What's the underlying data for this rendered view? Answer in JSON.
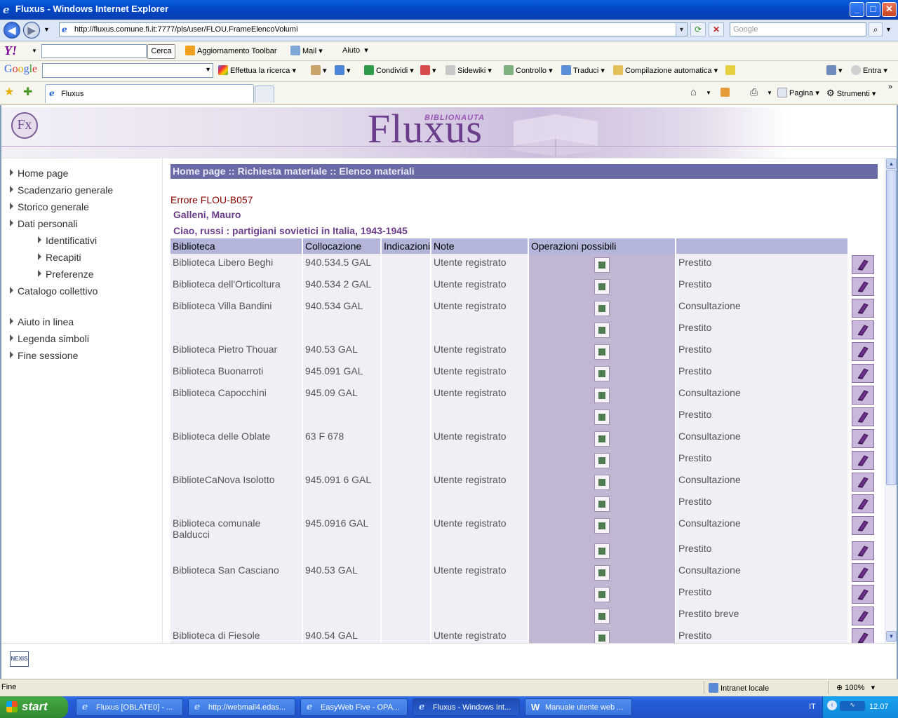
{
  "window": {
    "title": "Fluxus - Windows Internet Explorer",
    "min": "_",
    "max": "□",
    "close": "✕"
  },
  "address": {
    "url": "http://fluxus.comune.fi.it:7777/pls/user/FLOU.FrameElencoVolumi",
    "search_placeholder": "Google"
  },
  "yahoo_toolbar": {
    "logo": "Y!",
    "search_button": "Cerca",
    "update": "Aggiornamento Toolbar",
    "mail": "Mail",
    "help": "Aiuto"
  },
  "google_toolbar": {
    "logo": "Google",
    "search": "Effettua la ricerca",
    "share": "Condividi",
    "sidewiki": "Sidewiki",
    "check": "Controllo",
    "translate": "Traduci",
    "autofill": "Compilazione automatica",
    "signin": "Entra"
  },
  "tabs": {
    "active": "Fluxus",
    "page_menu": "Pagina",
    "tools_menu": "Strumenti"
  },
  "banner": {
    "logo": "Fx",
    "brand": "Fluxus",
    "brand_sub": "BIBLIONAUTA"
  },
  "sidebar": {
    "home": "Home page",
    "scadenzario": "Scadenzario generale",
    "storico": "Storico generale",
    "dati": "Dati personali",
    "identificativi": "Identificativi",
    "recapiti": "Recapiti",
    "preferenze": "Preferenze",
    "catalogo": "Catalogo collettivo",
    "aiuto": "Aiuto in linea",
    "legenda": "Legenda simboli",
    "fine": "Fine sessione"
  },
  "main": {
    "breadcrumb": "Home page :: Richiesta materiale :: Elenco materiali",
    "error": "Errore FLOU-B057",
    "author": "Galleni, Mauro",
    "title": "Ciao, russi : partigiani sovietici in Italia, 1943-1945",
    "headers": {
      "biblioteca": "Biblioteca",
      "collocazione": "Collocazione",
      "indicazioni": "Indicazioni",
      "note": "Note",
      "operazioni": "Operazioni possibili"
    },
    "rows": [
      {
        "biblioteca": "Biblioteca Libero Beghi",
        "collocazione": "940.534.5 GAL",
        "note": "Utente registrato",
        "op": "Prestito"
      },
      {
        "biblioteca": "Biblioteca dell'Orticoltura",
        "collocazione": "940.534 2 GAL",
        "note": "Utente registrato",
        "op": "Prestito"
      },
      {
        "biblioteca": "Biblioteca Villa Bandini",
        "collocazione": "940.534 GAL",
        "note": "Utente registrato",
        "op": "Consultazione"
      },
      {
        "biblioteca": "",
        "collocazione": "",
        "note": "",
        "op": "Prestito"
      },
      {
        "biblioteca": "Biblioteca Pietro Thouar",
        "collocazione": "940.53 GAL",
        "note": "Utente registrato",
        "op": "Prestito"
      },
      {
        "biblioteca": "Biblioteca Buonarroti",
        "collocazione": "945.091 GAL",
        "note": "Utente registrato",
        "op": "Prestito"
      },
      {
        "biblioteca": "Biblioteca Capocchini",
        "collocazione": "945.09 GAL",
        "note": "Utente registrato",
        "op": "Consultazione"
      },
      {
        "biblioteca": "",
        "collocazione": "",
        "note": "",
        "op": "Prestito"
      },
      {
        "biblioteca": "Biblioteca delle Oblate",
        "collocazione": "63 F 678",
        "note": "Utente registrato",
        "op": "Consultazione"
      },
      {
        "biblioteca": "",
        "collocazione": "",
        "note": "",
        "op": "Prestito"
      },
      {
        "biblioteca": "BiblioteCaNova Isolotto",
        "collocazione": "945.091 6 GAL",
        "note": "Utente registrato",
        "op": "Consultazione"
      },
      {
        "biblioteca": "",
        "collocazione": "",
        "note": "",
        "op": "Prestito"
      },
      {
        "biblioteca": "Biblioteca comunale Balducci",
        "collocazione": "945.0916 GAL",
        "note": "Utente registrato",
        "op": "Consultazione"
      },
      {
        "biblioteca": "",
        "collocazione": "",
        "note": "",
        "op": "Prestito"
      },
      {
        "biblioteca": "Biblioteca San Casciano",
        "collocazione": "940.53 GAL",
        "note": "Utente registrato",
        "op": "Consultazione"
      },
      {
        "biblioteca": "",
        "collocazione": "",
        "note": "",
        "op": "Prestito"
      },
      {
        "biblioteca": "",
        "collocazione": "",
        "note": "",
        "op": "Prestito breve"
      },
      {
        "biblioteca": "Biblioteca di Fiesole",
        "collocazione": "940.54 GAL",
        "note": "Utente registrato",
        "op": "Prestito"
      }
    ]
  },
  "footer": {
    "nexis": "NEXIS"
  },
  "status": {
    "text": "Fine",
    "zone": "Intranet locale",
    "zoom": "100%"
  },
  "taskbar": {
    "start": "start",
    "buttons": [
      "Fluxus [OBLATE0] - ...",
      "http://webmail4.edas...",
      "EasyWeb Five - OPA...",
      "Fluxus - Windows Int...",
      "Manuale utente web ..."
    ],
    "lang": "IT",
    "clock": "12.07"
  },
  "colors": {
    "accent": "#6b3d8a",
    "header_bar": "#6a6aa6",
    "table_header": "#b3b6da",
    "op_cell": "#c1b7d2"
  }
}
